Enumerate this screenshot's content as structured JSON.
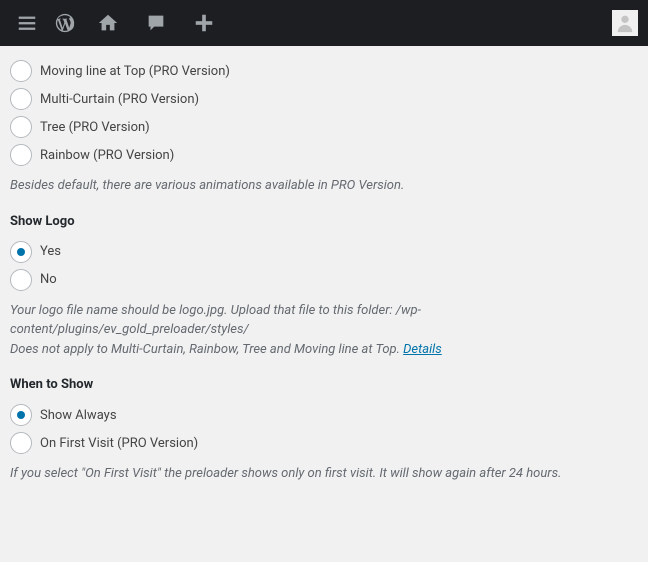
{
  "animations": {
    "options": [
      {
        "label": "Moving line at Top (PRO Version)",
        "checked": false
      },
      {
        "label": "Multi-Curtain (PRO Version)",
        "checked": false
      },
      {
        "label": "Tree (PRO Version)",
        "checked": false
      },
      {
        "label": "Rainbow (PRO Version)",
        "checked": false
      }
    ],
    "description": "Besides default, there are various animations available in PRO Version."
  },
  "show_logo": {
    "title": "Show Logo",
    "options": [
      {
        "label": "Yes",
        "checked": true
      },
      {
        "label": "No",
        "checked": false
      }
    ],
    "description_line1": "Your logo file name should be logo.jpg. Upload that file to this folder: /wp-content/plugins/ev_gold_preloader/styles/",
    "description_line2": "Does not apply to Multi-Curtain, Rainbow, Tree and Moving line at Top. ",
    "details_link": "Details"
  },
  "when_to_show": {
    "title": "When to Show",
    "options": [
      {
        "label": "Show Always",
        "checked": true
      },
      {
        "label": "On First Visit (PRO Version)",
        "checked": false
      }
    ],
    "description": "If you select \"On First Visit\" the preloader shows only on first visit. It will show again after 24 hours."
  }
}
